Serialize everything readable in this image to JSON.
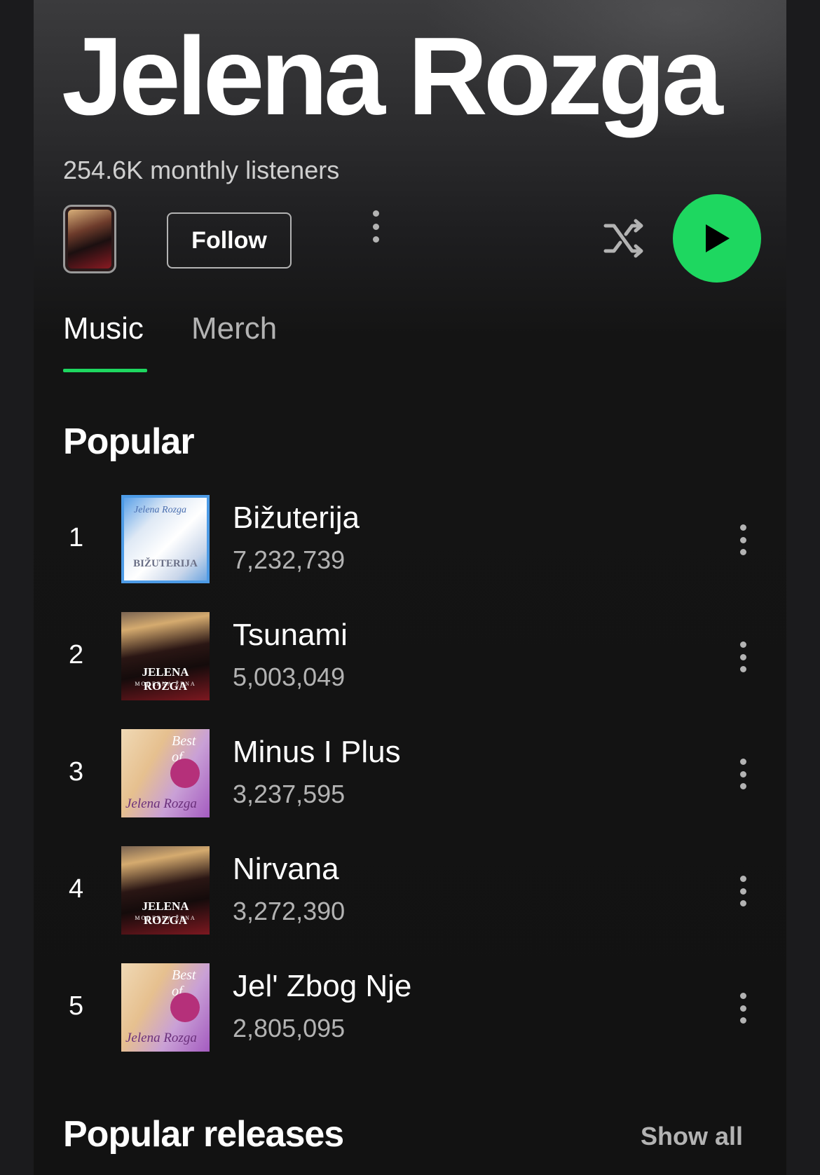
{
  "artist": {
    "name": "Jelena Rozga",
    "monthly_listeners": "254.6K monthly listeners",
    "avatar_cover_text": "ELENA ROZG"
  },
  "actions": {
    "follow_label": "Follow",
    "more_icon": "more-vertical-icon",
    "shuffle_icon": "shuffle-icon",
    "play_icon": "play-icon",
    "play_color": "#1ed760"
  },
  "tabs": [
    {
      "label": "Music",
      "active": true
    },
    {
      "label": "Merch",
      "active": false
    }
  ],
  "popular": {
    "title": "Popular",
    "tracks": [
      {
        "rank": "1",
        "title": "Bižuterija",
        "plays": "7,232,739",
        "cover_text": "BIŽUTERIJA",
        "cover_script": "Jelena Rozga"
      },
      {
        "rank": "2",
        "title": "Tsunami",
        "plays": "5,003,049",
        "cover_text": "JELENA ROZGA",
        "cover_sub": "MODERNA ŽENA"
      },
      {
        "rank": "3",
        "title": "Minus I Plus",
        "plays": "3,237,595",
        "cover_text": "Best of",
        "cover_script": "Jelena Rozga"
      },
      {
        "rank": "4",
        "title": "Nirvana",
        "plays": "3,272,390",
        "cover_text": "JELENA ROZGA",
        "cover_sub": "MODERNA ŽENA"
      },
      {
        "rank": "5",
        "title": "Jel' Zbog Nje",
        "plays": "2,805,095",
        "cover_text": "Best of",
        "cover_script": "Jelena Rozga"
      }
    ]
  },
  "popular_releases": {
    "title": "Popular releases",
    "show_all_label": "Show all"
  },
  "colors": {
    "accent": "#1ed760",
    "background": "#121212",
    "secondary_text": "#b3b3b3"
  }
}
